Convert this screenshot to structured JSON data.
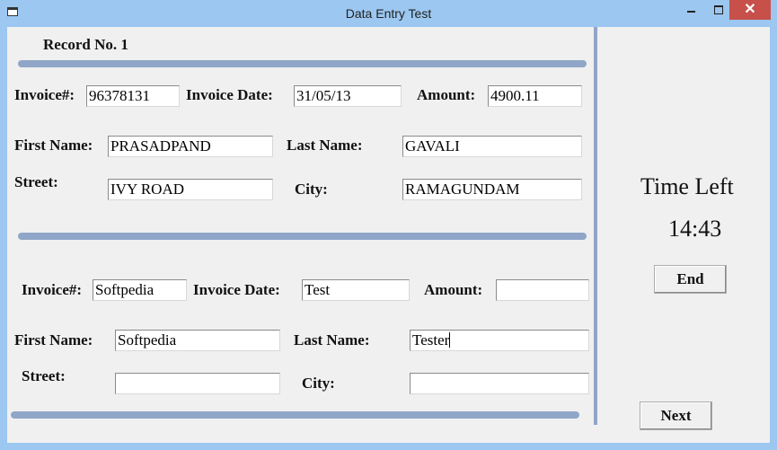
{
  "window": {
    "title": "Data Entry Test",
    "close_symbol": "✕"
  },
  "record": {
    "heading": "Record No. 1",
    "invoice_label": "Invoice#:",
    "invoice_value": "96378131",
    "date_label": "Invoice Date:",
    "date_value": "31/05/13",
    "amount_label": "Amount:",
    "amount_value": "4900.11",
    "first_name_label": "First Name:",
    "first_name_value": "PRASADPAND",
    "last_name_label": "Last Name:",
    "last_name_value": "GAVALI",
    "street_label": "Street:",
    "street_value": "IVY ROAD",
    "city_label": "City:",
    "city_value": "RAMAGUNDAM"
  },
  "entry": {
    "invoice_label": "Invoice#:",
    "invoice_value": "Softpedia",
    "date_label": "Invoice Date:",
    "date_value": "Test",
    "amount_label": "Amount:",
    "amount_value": "",
    "first_name_label": "First Name:",
    "first_name_value": "Softpedia",
    "last_name_label": "Last Name:",
    "last_name_value": "Tester",
    "street_label": "Street:",
    "street_value": "",
    "city_label": "City:",
    "city_value": ""
  },
  "timer": {
    "label": "Time Left",
    "value": "14:43"
  },
  "buttons": {
    "end": "End",
    "next": "Next"
  },
  "colors": {
    "window_frame": "#9bc7f0",
    "client_bg": "#f0f0f0",
    "separator": "#8fa6c8",
    "close_button": "#c7504b"
  }
}
